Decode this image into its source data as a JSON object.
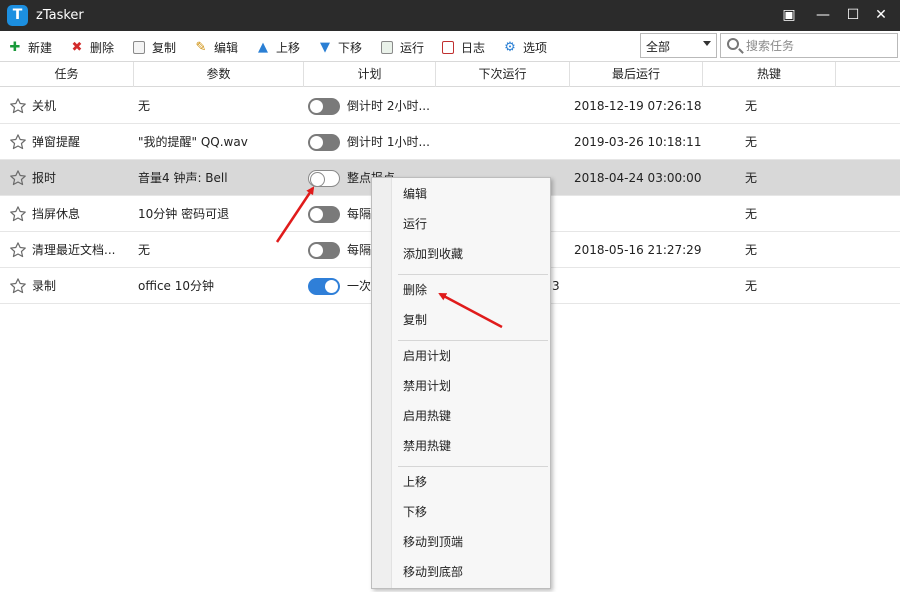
{
  "window": {
    "logo_letter": "T",
    "title": "zTasker",
    "controls": {
      "menu": "▣",
      "minimize": "—",
      "maximize": "☐",
      "close": "✕"
    }
  },
  "toolbar": {
    "buttons": [
      {
        "label": "新建",
        "icon": "plus-icon",
        "glyph": "✚",
        "color": "#1a9a3a"
      },
      {
        "label": "删除",
        "icon": "delete-icon",
        "glyph": "✖",
        "color": "#d22b2b"
      },
      {
        "label": "复制",
        "icon": "copy-icon",
        "glyph": "",
        "color": "#666666"
      },
      {
        "label": "编辑",
        "icon": "edit-icon",
        "glyph": "✎",
        "color": "#cc8a00"
      },
      {
        "label": "上移",
        "icon": "arrow-up-icon",
        "glyph": "🡅",
        "color": "#2a7fd4"
      },
      {
        "label": "下移",
        "icon": "arrow-down-icon",
        "glyph": "🡇",
        "color": "#2a7fd4"
      },
      {
        "label": "运行",
        "icon": "run-icon",
        "glyph": "",
        "color": "#666666"
      },
      {
        "label": "日志",
        "icon": "log-icon",
        "glyph": "",
        "color": "#c03030"
      },
      {
        "label": "选项",
        "icon": "gear-icon",
        "glyph": "⚙",
        "color": "#2a7fd4"
      }
    ],
    "filter": {
      "selected": "全部"
    },
    "search": {
      "placeholder": "搜索任务"
    }
  },
  "table": {
    "columns": [
      "任务",
      "参数",
      "计划",
      "下次运行",
      "最后运行",
      "热键"
    ],
    "rows": [
      {
        "task": "关机",
        "params": "无",
        "enabled": false,
        "plan": "倒计时 2小时...",
        "next": "",
        "last": "2018-12-19 07:26:18",
        "hotkey": "无",
        "selected": false
      },
      {
        "task": "弹窗提醒",
        "params": "\"我的提醒\" QQ.wav",
        "enabled": false,
        "plan": "倒计时 1小时...",
        "next": "",
        "last": "2019-03-26 10:18:11",
        "hotkey": "无",
        "selected": false
      },
      {
        "task": "报时",
        "params": "音量4 钟声: Bell",
        "enabled": false,
        "plan": "整点报点",
        "next": "",
        "last": "2018-04-24 03:00:00",
        "hotkey": "无",
        "selected": true
      },
      {
        "task": "挡屏休息",
        "params": "10分钟 密码可退",
        "enabled": false,
        "plan": "每隔",
        "next": "",
        "last": "",
        "hotkey": "无",
        "selected": false
      },
      {
        "task": "清理最近文档...",
        "params": "无",
        "enabled": false,
        "plan": "每隔",
        "next": "",
        "last": "2018-05-16 21:27:29",
        "hotkey": "无",
        "selected": false
      },
      {
        "task": "录制",
        "params": "office 10分钟",
        "enabled": true,
        "plan": "一次",
        "next": "3",
        "last": "",
        "hotkey": "无",
        "selected": false
      }
    ]
  },
  "context_menu": {
    "groups": [
      [
        "编辑",
        "运行",
        "添加到收藏"
      ],
      [
        "删除",
        "复制"
      ],
      [
        "启用计划",
        "禁用计划",
        "启用热键",
        "禁用热键"
      ],
      [
        "上移",
        "下移",
        "移动到顶端",
        "移动到底部"
      ]
    ]
  },
  "annotations": {
    "arrow_color": "#e01b1b"
  }
}
